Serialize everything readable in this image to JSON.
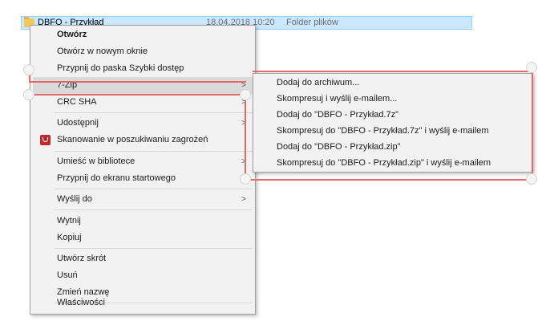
{
  "explorer": {
    "file_name": "DBFO - Przykład",
    "file_date": "18.04.2018 10:20",
    "file_type": "Folder plików"
  },
  "menu": {
    "items": [
      {
        "label": "Otwórz"
      },
      {
        "label": "Otwórz w nowym oknie"
      },
      {
        "label": "Przypnij do paska Szybki dostęp"
      },
      {
        "label": "7-Zip"
      },
      {
        "label": "CRC SHA"
      },
      {
        "label": "Udostępnij"
      },
      {
        "label": "Skanowanie w poszukiwaniu zagrożeń"
      },
      {
        "label": "Umieść w bibliotece"
      },
      {
        "label": "Przypnij do ekranu startowego"
      },
      {
        "label": "Wyślij do"
      },
      {
        "label": "Wytnij"
      },
      {
        "label": "Kopiuj"
      },
      {
        "label": "Utwórz skrót"
      },
      {
        "label": "Usuń"
      },
      {
        "label": "Zmień nazwę"
      },
      {
        "label": "Właściwości"
      }
    ],
    "submenu_arrow": ">"
  },
  "submenu": {
    "items": [
      {
        "label": "Dodaj do archiwum..."
      },
      {
        "label": "Skompresuj i wyślij e-mailem..."
      },
      {
        "label": "Dodaj do \"DBFO - Przykład.7z\""
      },
      {
        "label": "Skompresuj do \"DBFO - Przykład.7z\" i wyślij e-mailem"
      },
      {
        "label": "Dodaj do \"DBFO - Przykład.zip\""
      },
      {
        "label": "Skompresuj do \"DBFO - Przykład.zip\" i wyślij e-mailem"
      }
    ]
  },
  "colors": {
    "selection": "#cce8ff",
    "menu_bg": "#f2f2f2",
    "highlight": "#dadada",
    "annotation": "#e36a6a"
  }
}
